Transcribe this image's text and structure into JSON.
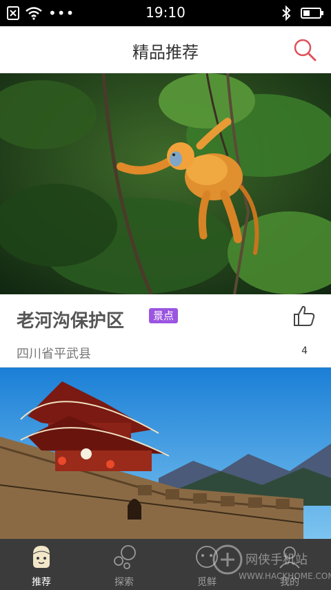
{
  "status_bar": {
    "time": "19:10"
  },
  "header": {
    "title": "精品推荐"
  },
  "cards": [
    {
      "title": "老河沟保护区",
      "tag": "景点",
      "location": "四川省平武县",
      "likes": "4",
      "image": "golden-snub-nosed-monkey-in-forest"
    },
    {
      "image": "ancient-city-wall-and-tower"
    }
  ],
  "tabs": [
    {
      "label": "推荐",
      "icon": "recommend-icon",
      "active": true
    },
    {
      "label": "探索",
      "icon": "explore-icon",
      "active": false
    },
    {
      "label": "觅鲜",
      "icon": "discover-icon",
      "active": false
    },
    {
      "label": "我的",
      "icon": "profile-icon",
      "active": false
    }
  ],
  "watermark": {
    "line1": "网侠手机站",
    "line2": "WWW.HACKHOME.COM"
  },
  "colors": {
    "status_bg": "#000000",
    "tag_bg": "#9b55e0",
    "search_icon": "#e0505a",
    "tabbar_bg": "#3b3b3b"
  }
}
